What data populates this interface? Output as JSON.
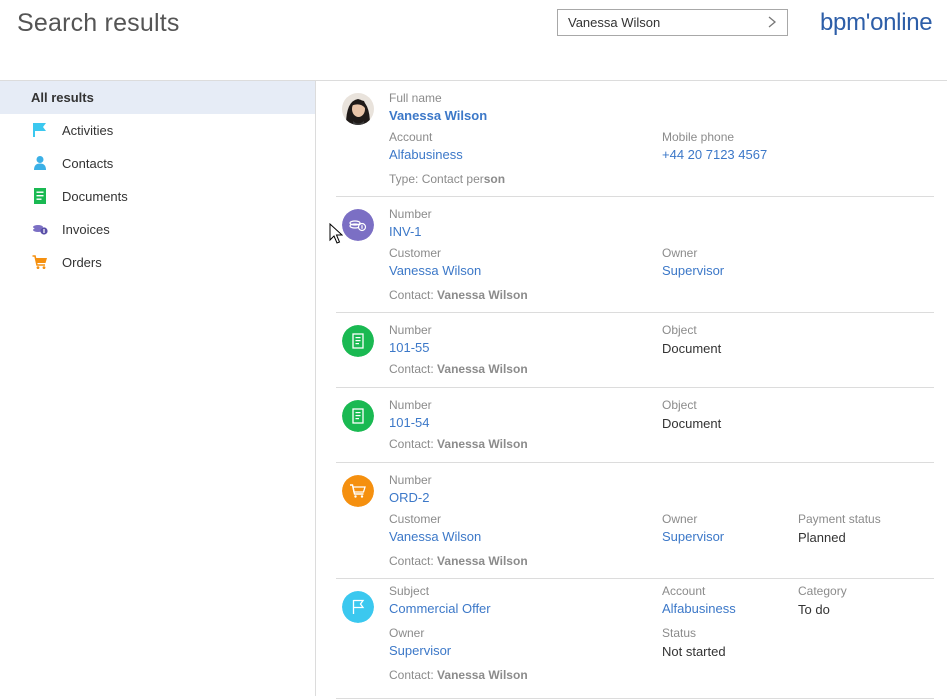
{
  "header": {
    "title": "Search results",
    "search_value": "Vanessa Wilson",
    "logo_text": "bpm'online"
  },
  "sidebar": {
    "items": [
      {
        "label": "All results",
        "icon": "none",
        "active": true
      },
      {
        "label": "Activities",
        "icon": "flag-icon"
      },
      {
        "label": "Contacts",
        "icon": "person-icon"
      },
      {
        "label": "Documents",
        "icon": "document-icon"
      },
      {
        "label": "Invoices",
        "icon": "coins-icon"
      },
      {
        "label": "Orders",
        "icon": "cart-icon"
      }
    ]
  },
  "results": {
    "contact": {
      "full_name_label": "Full name",
      "full_name": "Vanessa Wilson",
      "account_label": "Account",
      "account": "Alfabusiness",
      "mobile_label": "Mobile phone",
      "mobile": "+44 20 7123 4567",
      "type_label": "Type:",
      "type_value": "Contact per",
      "type_value_bold": "son"
    },
    "invoice": {
      "number_label": "Number",
      "number": "INV-1",
      "customer_label": "Customer",
      "customer": "Vanessa Wilson",
      "owner_label": "Owner",
      "owner": "Supervisor",
      "contact_label": "Contact:",
      "contact": "Vanessa Wilson"
    },
    "document1": {
      "number_label": "Number",
      "number": "101-55",
      "object_label": "Object",
      "object": "Document",
      "contact_label": "Contact:",
      "contact": "Vanessa Wilson"
    },
    "document2": {
      "number_label": "Number",
      "number": "101-54",
      "object_label": "Object",
      "object": "Document",
      "contact_label": "Contact:",
      "contact": "Vanessa Wilson"
    },
    "order": {
      "number_label": "Number",
      "number": "ORD-2",
      "customer_label": "Customer",
      "customer": "Vanessa Wilson",
      "owner_label": "Owner",
      "owner": "Supervisor",
      "payment_label": "Payment status",
      "payment": "Planned",
      "contact_label": "Contact:",
      "contact": "Vanessa Wilson"
    },
    "activity": {
      "subject_label": "Subject",
      "subject": "Commercial Offer",
      "account_label": "Account",
      "account": "Alfabusiness",
      "category_label": "Category",
      "category": "To do",
      "owner_label": "Owner",
      "owner": "Supervisor",
      "status_label": "Status",
      "status": "Not started",
      "contact_label": "Contact:",
      "contact": "Vanessa Wilson"
    }
  },
  "colors": {
    "accent_blue": "#3c78c8",
    "invoice": "#7b6fc4",
    "document": "#1ab952",
    "order": "#f5900f",
    "activity": "#3bc8ef",
    "sidebar_active": "#e6ecf6"
  }
}
